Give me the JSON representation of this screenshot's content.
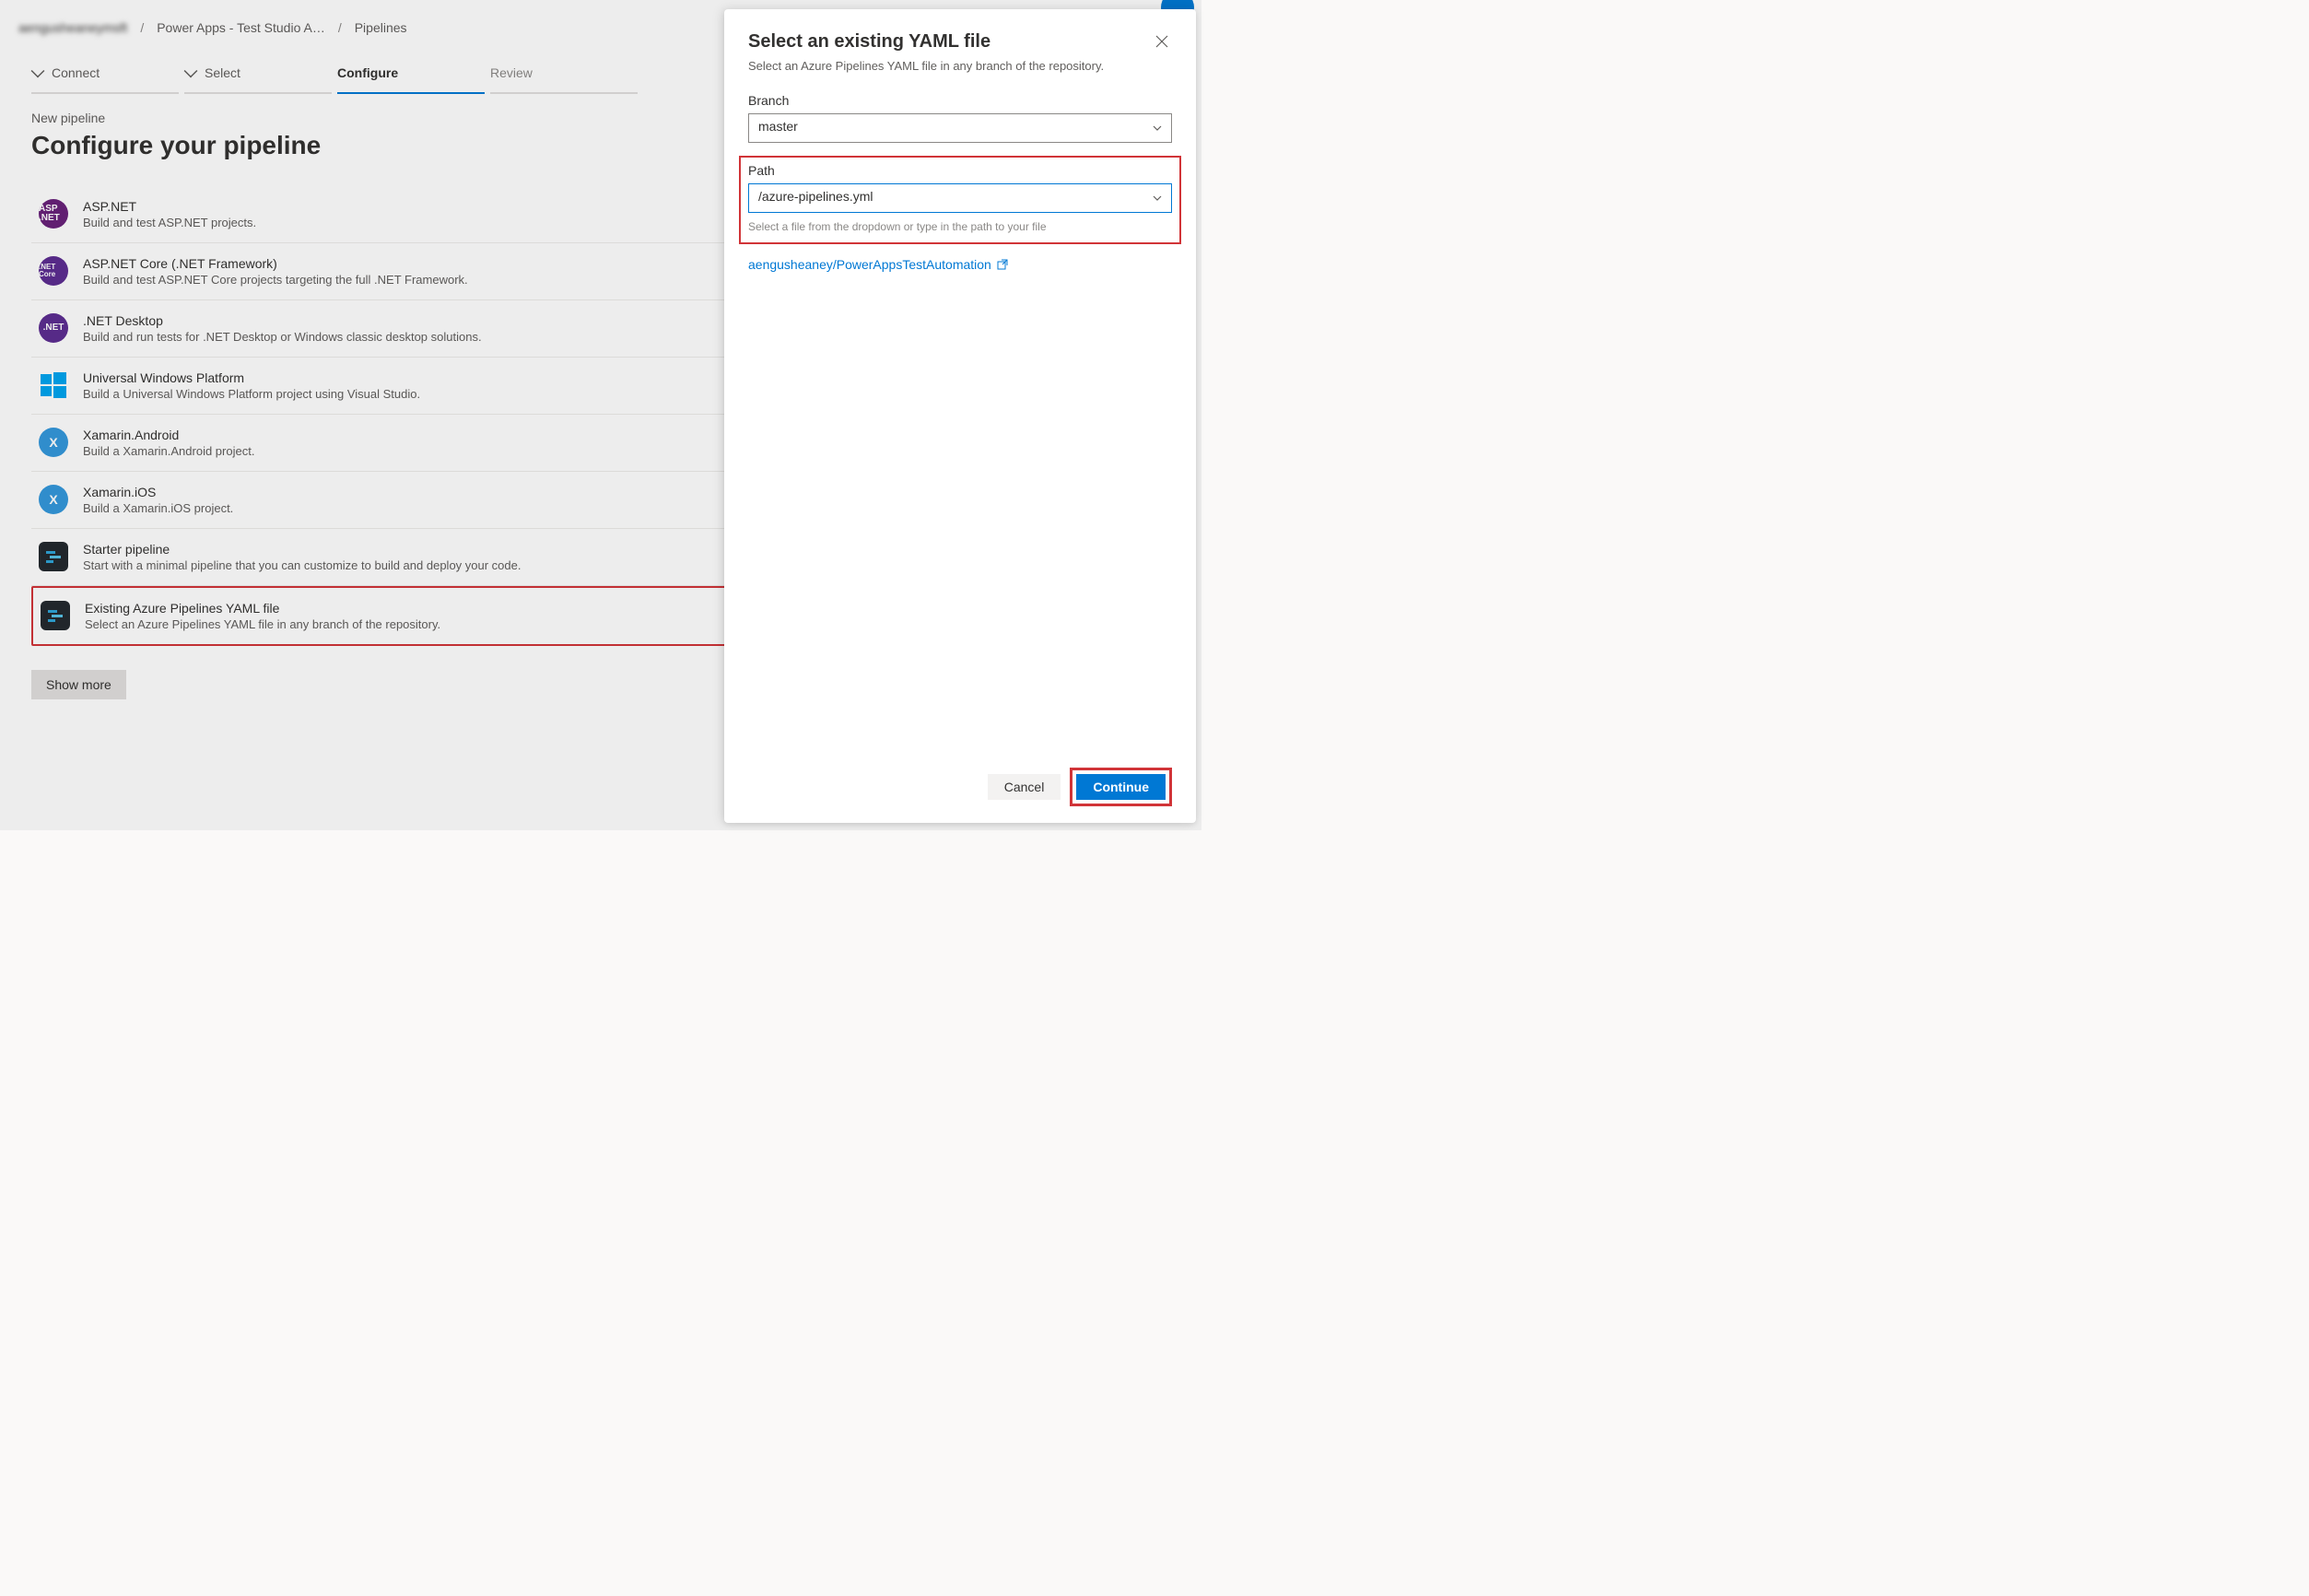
{
  "breadcrumb": {
    "org": "aengusheaneymsft",
    "project": "Power Apps - Test Studio A…",
    "page": "Pipelines"
  },
  "steps": {
    "connect": "Connect",
    "select": "Select",
    "configure": "Configure",
    "review": "Review"
  },
  "subhead": "New pipeline",
  "page_title": "Configure your pipeline",
  "options": [
    {
      "title": "ASP.NET",
      "desc": "Build and test ASP.NET projects.",
      "icon": "aspnet",
      "label": "ASP\n.NET"
    },
    {
      "title": "ASP.NET Core (.NET Framework)",
      "desc": "Build and test ASP.NET Core projects targeting the full .NET Framework.",
      "icon": "aspnetcore",
      "label": ".NET\nCore"
    },
    {
      "title": ".NET Desktop",
      "desc": "Build and run tests for .NET Desktop or Windows classic desktop solutions.",
      "icon": "netdesk",
      "label": ".NET"
    },
    {
      "title": "Universal Windows Platform",
      "desc": "Build a Universal Windows Platform project using Visual Studio.",
      "icon": "uwp",
      "label": ""
    },
    {
      "title": "Xamarin.Android",
      "desc": "Build a Xamarin.Android project.",
      "icon": "xam",
      "label": ""
    },
    {
      "title": "Xamarin.iOS",
      "desc": "Build a Xamarin.iOS project.",
      "icon": "xam",
      "label": ""
    },
    {
      "title": "Starter pipeline",
      "desc": "Start with a minimal pipeline that you can customize to build and deploy your code.",
      "icon": "pipe",
      "label": ""
    },
    {
      "title": "Existing Azure Pipelines YAML file",
      "desc": "Select an Azure Pipelines YAML file in any branch of the repository.",
      "icon": "pipe",
      "label": "",
      "highlight": true
    }
  ],
  "show_more": "Show more",
  "panel": {
    "title": "Select an existing YAML file",
    "desc": "Select an Azure Pipelines YAML file in any branch of the repository.",
    "branch_label": "Branch",
    "branch_value": "master",
    "path_label": "Path",
    "path_value": "/azure-pipelines.yml",
    "path_hint": "Select a file from the dropdown or type in the path to your file",
    "repo_link": "aengusheaney/PowerAppsTestAutomation",
    "cancel": "Cancel",
    "continue": "Continue"
  }
}
